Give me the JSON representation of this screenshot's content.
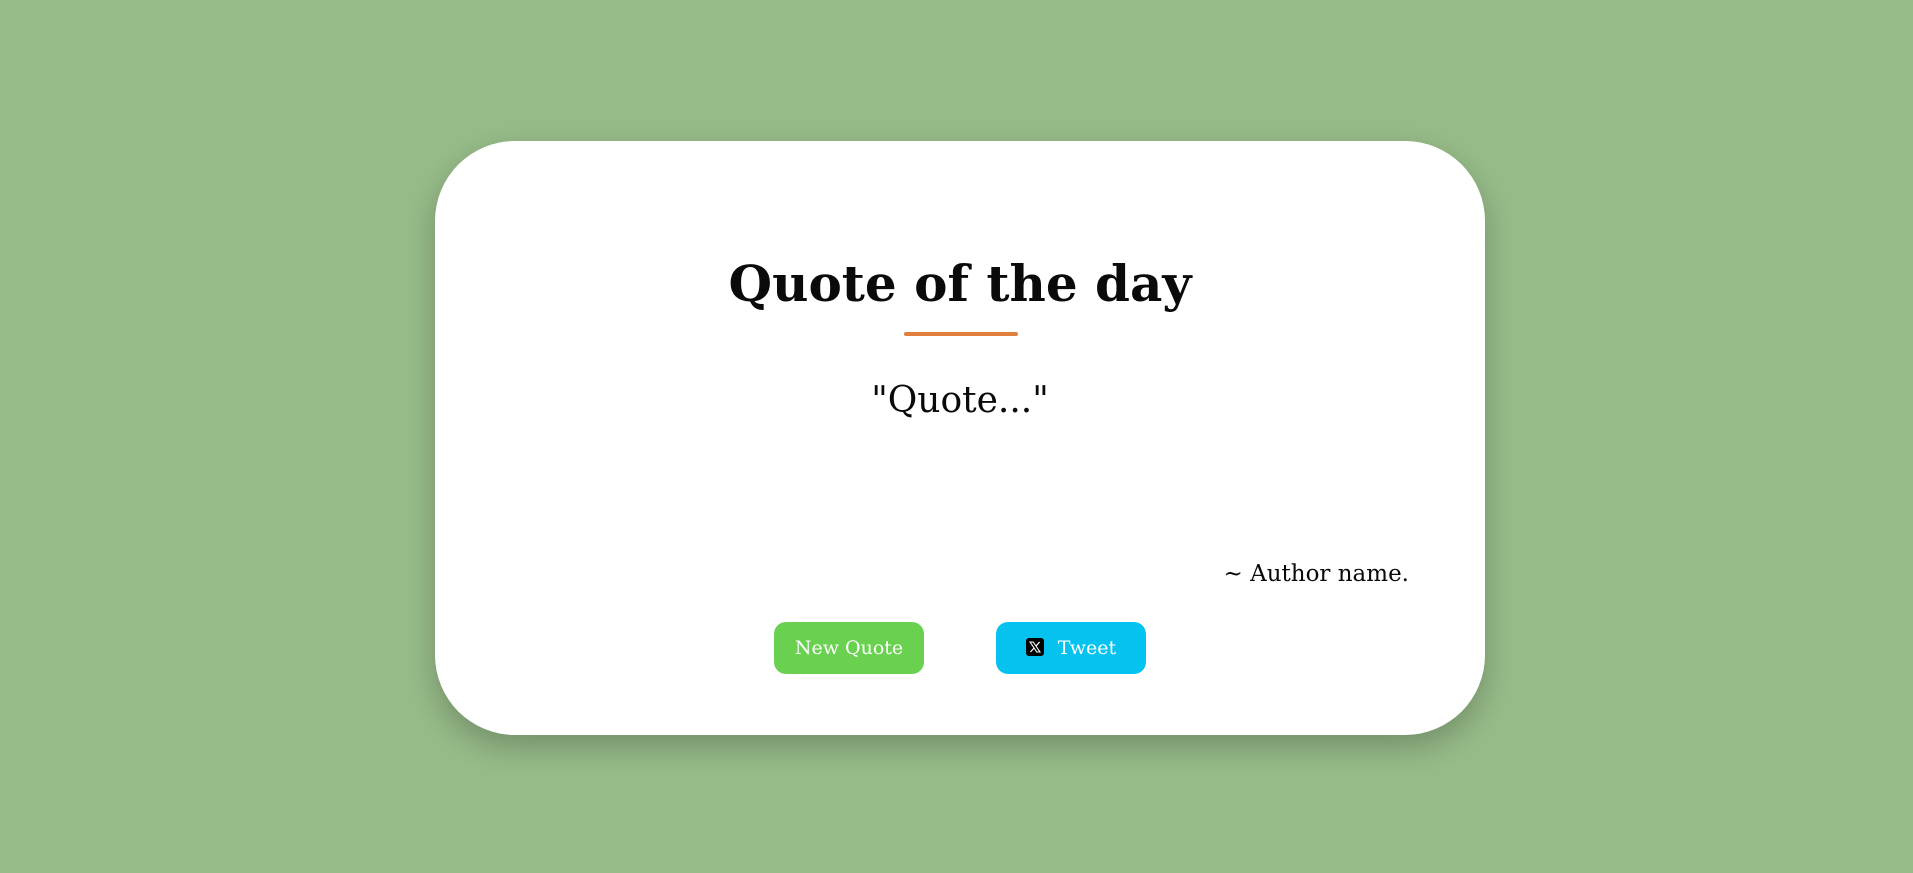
{
  "page": {
    "background_color": "#96ba88"
  },
  "card": {
    "title": "Quote of the day",
    "accent_color": "#e07f3c",
    "quote": "\"Quote...\"",
    "author": "~ Author name."
  },
  "buttons": {
    "new_quote_label": "New Quote",
    "new_quote_color": "#69d14f",
    "tweet_label": "Tweet",
    "tweet_color": "#05c3ee",
    "tweet_icon": "x-logo-icon"
  }
}
